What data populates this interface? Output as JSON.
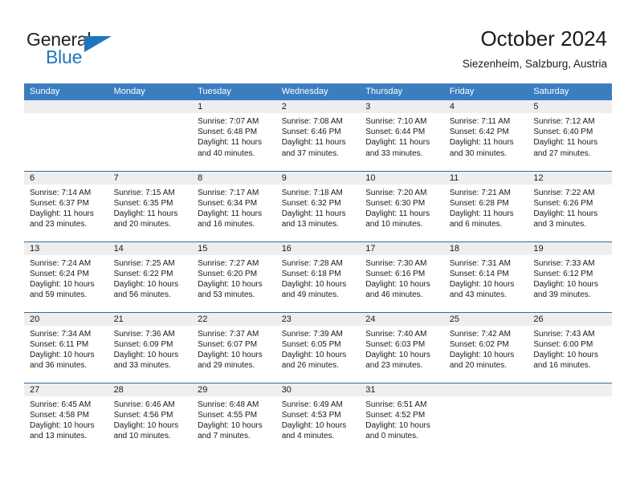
{
  "brand": {
    "name_top": "General",
    "name_bottom": "Blue",
    "accent_color": "#1f76bc"
  },
  "header": {
    "title": "October 2024",
    "subtitle": "Siezenheim, Salzburg, Austria"
  },
  "calendar": {
    "header_bg": "#3b7ebf",
    "daynum_bg": "#eeeeee",
    "grid_line_color": "#2e6da4",
    "weekday_headers": [
      "Sunday",
      "Monday",
      "Tuesday",
      "Wednesday",
      "Thursday",
      "Friday",
      "Saturday"
    ],
    "labels": {
      "sunrise": "Sunrise:",
      "sunset": "Sunset:",
      "daylight": "Daylight:"
    },
    "weeks": [
      [
        {
          "day": "",
          "sunrise": "",
          "sunset": "",
          "daylight": ""
        },
        {
          "day": "",
          "sunrise": "",
          "sunset": "",
          "daylight": ""
        },
        {
          "day": "1",
          "sunrise": "Sunrise: 7:07 AM",
          "sunset": "Sunset: 6:48 PM",
          "daylight": "Daylight: 11 hours and 40 minutes."
        },
        {
          "day": "2",
          "sunrise": "Sunrise: 7:08 AM",
          "sunset": "Sunset: 6:46 PM",
          "daylight": "Daylight: 11 hours and 37 minutes."
        },
        {
          "day": "3",
          "sunrise": "Sunrise: 7:10 AM",
          "sunset": "Sunset: 6:44 PM",
          "daylight": "Daylight: 11 hours and 33 minutes."
        },
        {
          "day": "4",
          "sunrise": "Sunrise: 7:11 AM",
          "sunset": "Sunset: 6:42 PM",
          "daylight": "Daylight: 11 hours and 30 minutes."
        },
        {
          "day": "5",
          "sunrise": "Sunrise: 7:12 AM",
          "sunset": "Sunset: 6:40 PM",
          "daylight": "Daylight: 11 hours and 27 minutes."
        }
      ],
      [
        {
          "day": "6",
          "sunrise": "Sunrise: 7:14 AM",
          "sunset": "Sunset: 6:37 PM",
          "daylight": "Daylight: 11 hours and 23 minutes."
        },
        {
          "day": "7",
          "sunrise": "Sunrise: 7:15 AM",
          "sunset": "Sunset: 6:35 PM",
          "daylight": "Daylight: 11 hours and 20 minutes."
        },
        {
          "day": "8",
          "sunrise": "Sunrise: 7:17 AM",
          "sunset": "Sunset: 6:34 PM",
          "daylight": "Daylight: 11 hours and 16 minutes."
        },
        {
          "day": "9",
          "sunrise": "Sunrise: 7:18 AM",
          "sunset": "Sunset: 6:32 PM",
          "daylight": "Daylight: 11 hours and 13 minutes."
        },
        {
          "day": "10",
          "sunrise": "Sunrise: 7:20 AM",
          "sunset": "Sunset: 6:30 PM",
          "daylight": "Daylight: 11 hours and 10 minutes."
        },
        {
          "day": "11",
          "sunrise": "Sunrise: 7:21 AM",
          "sunset": "Sunset: 6:28 PM",
          "daylight": "Daylight: 11 hours and 6 minutes."
        },
        {
          "day": "12",
          "sunrise": "Sunrise: 7:22 AM",
          "sunset": "Sunset: 6:26 PM",
          "daylight": "Daylight: 11 hours and 3 minutes."
        }
      ],
      [
        {
          "day": "13",
          "sunrise": "Sunrise: 7:24 AM",
          "sunset": "Sunset: 6:24 PM",
          "daylight": "Daylight: 10 hours and 59 minutes."
        },
        {
          "day": "14",
          "sunrise": "Sunrise: 7:25 AM",
          "sunset": "Sunset: 6:22 PM",
          "daylight": "Daylight: 10 hours and 56 minutes."
        },
        {
          "day": "15",
          "sunrise": "Sunrise: 7:27 AM",
          "sunset": "Sunset: 6:20 PM",
          "daylight": "Daylight: 10 hours and 53 minutes."
        },
        {
          "day": "16",
          "sunrise": "Sunrise: 7:28 AM",
          "sunset": "Sunset: 6:18 PM",
          "daylight": "Daylight: 10 hours and 49 minutes."
        },
        {
          "day": "17",
          "sunrise": "Sunrise: 7:30 AM",
          "sunset": "Sunset: 6:16 PM",
          "daylight": "Daylight: 10 hours and 46 minutes."
        },
        {
          "day": "18",
          "sunrise": "Sunrise: 7:31 AM",
          "sunset": "Sunset: 6:14 PM",
          "daylight": "Daylight: 10 hours and 43 minutes."
        },
        {
          "day": "19",
          "sunrise": "Sunrise: 7:33 AM",
          "sunset": "Sunset: 6:12 PM",
          "daylight": "Daylight: 10 hours and 39 minutes."
        }
      ],
      [
        {
          "day": "20",
          "sunrise": "Sunrise: 7:34 AM",
          "sunset": "Sunset: 6:11 PM",
          "daylight": "Daylight: 10 hours and 36 minutes."
        },
        {
          "day": "21",
          "sunrise": "Sunrise: 7:36 AM",
          "sunset": "Sunset: 6:09 PM",
          "daylight": "Daylight: 10 hours and 33 minutes."
        },
        {
          "day": "22",
          "sunrise": "Sunrise: 7:37 AM",
          "sunset": "Sunset: 6:07 PM",
          "daylight": "Daylight: 10 hours and 29 minutes."
        },
        {
          "day": "23",
          "sunrise": "Sunrise: 7:39 AM",
          "sunset": "Sunset: 6:05 PM",
          "daylight": "Daylight: 10 hours and 26 minutes."
        },
        {
          "day": "24",
          "sunrise": "Sunrise: 7:40 AM",
          "sunset": "Sunset: 6:03 PM",
          "daylight": "Daylight: 10 hours and 23 minutes."
        },
        {
          "day": "25",
          "sunrise": "Sunrise: 7:42 AM",
          "sunset": "Sunset: 6:02 PM",
          "daylight": "Daylight: 10 hours and 20 minutes."
        },
        {
          "day": "26",
          "sunrise": "Sunrise: 7:43 AM",
          "sunset": "Sunset: 6:00 PM",
          "daylight": "Daylight: 10 hours and 16 minutes."
        }
      ],
      [
        {
          "day": "27",
          "sunrise": "Sunrise: 6:45 AM",
          "sunset": "Sunset: 4:58 PM",
          "daylight": "Daylight: 10 hours and 13 minutes."
        },
        {
          "day": "28",
          "sunrise": "Sunrise: 6:46 AM",
          "sunset": "Sunset: 4:56 PM",
          "daylight": "Daylight: 10 hours and 10 minutes."
        },
        {
          "day": "29",
          "sunrise": "Sunrise: 6:48 AM",
          "sunset": "Sunset: 4:55 PM",
          "daylight": "Daylight: 10 hours and 7 minutes."
        },
        {
          "day": "30",
          "sunrise": "Sunrise: 6:49 AM",
          "sunset": "Sunset: 4:53 PM",
          "daylight": "Daylight: 10 hours and 4 minutes."
        },
        {
          "day": "31",
          "sunrise": "Sunrise: 6:51 AM",
          "sunset": "Sunset: 4:52 PM",
          "daylight": "Daylight: 10 hours and 0 minutes."
        },
        {
          "day": "",
          "sunrise": "",
          "sunset": "",
          "daylight": ""
        },
        {
          "day": "",
          "sunrise": "",
          "sunset": "",
          "daylight": ""
        }
      ]
    ]
  }
}
